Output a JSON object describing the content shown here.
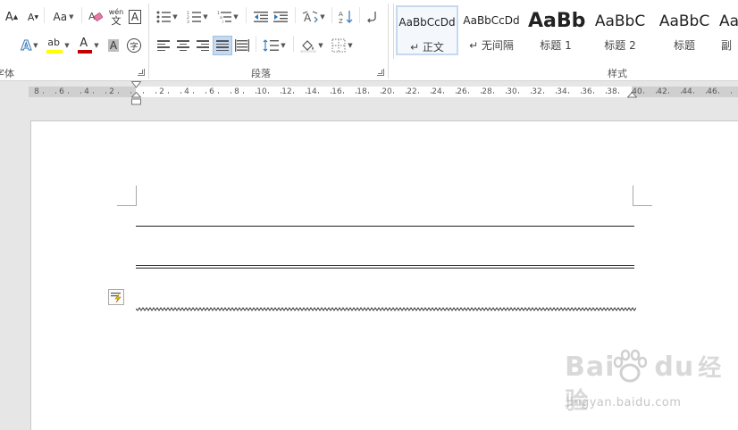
{
  "ribbon": {
    "groups": {
      "font": "字体",
      "paragraph": "段落",
      "styles": "样式"
    },
    "font_row1": {
      "grow_font": "A",
      "shrink_font": "A",
      "change_case": "Aa",
      "phonetic_top": "wén",
      "phonetic_bottom": "文",
      "char_border": "A"
    },
    "font_row2": {
      "text_effects": "A",
      "highlight": "ab",
      "font_color": "A",
      "char_shading": "A",
      "enclose_char": "字"
    },
    "colors": {
      "highlight_bar": "#ffff00",
      "font_color_bar": "#c00000",
      "text_effects": "#2e75b6"
    },
    "styles": [
      {
        "sample": "AaBbCcDd",
        "name": "↵ 正文",
        "selected": true
      },
      {
        "sample": "AaBbCcDd",
        "name": "↵ 无间隔",
        "selected": false
      },
      {
        "sample": "AaBb",
        "name": "标题 1",
        "selected": false
      },
      {
        "sample": "AaBbC",
        "name": "标题 2",
        "selected": false
      },
      {
        "sample": "AaBbC",
        "name": "标题",
        "selected": false
      },
      {
        "sample": "Aa",
        "name": "副",
        "selected": false
      }
    ]
  },
  "ruler": {
    "left_numbers": [
      "8",
      "6",
      "4",
      "2"
    ],
    "right_numbers": [
      "2",
      "4",
      "6",
      "8",
      "10",
      "12",
      "14",
      "16",
      "18",
      "20",
      "22",
      "24",
      "26",
      "28",
      "30",
      "32",
      "34",
      "36",
      "38",
      "40",
      "42",
      "44",
      "46"
    ]
  },
  "watermark": {
    "logo_text_left": "Bai",
    "logo_text_mid": "du",
    "logo_text_right": "经验",
    "url": "jingyan.baidu.com"
  }
}
